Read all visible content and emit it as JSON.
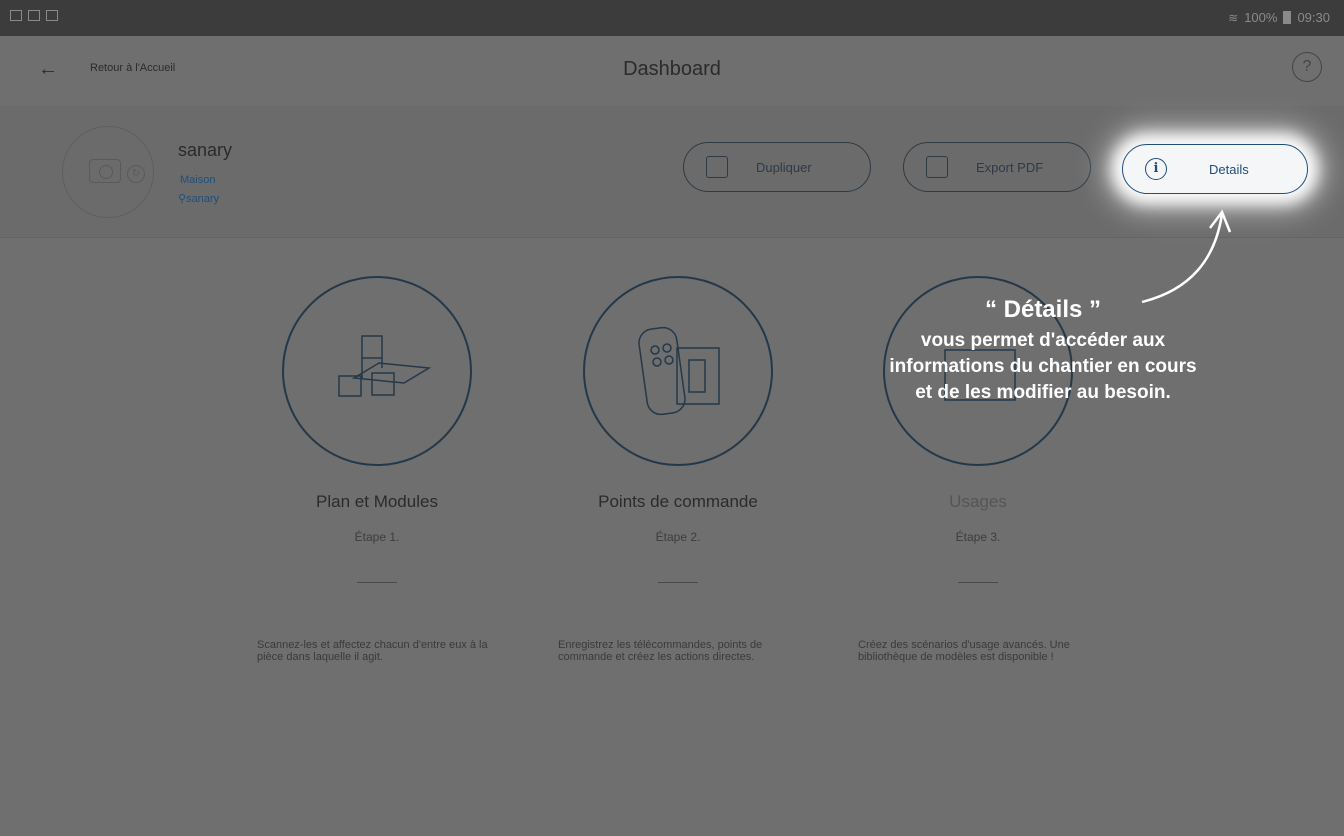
{
  "statusbar": {
    "battery": "100%",
    "time": "09:30"
  },
  "appbar": {
    "back_label": "Retour à l'Accueil",
    "title": "Dashboard",
    "help": "?"
  },
  "project": {
    "name": "sanary",
    "type": "Maison",
    "location": "sanary"
  },
  "actions": {
    "duplicate": "Dupliquer",
    "export": "Export PDF",
    "details": "Details"
  },
  "steps": [
    {
      "name": "Plan et Modules",
      "step": "Étape 1.",
      "desc": "Scannez-les et affectez chacun d'entre eux à la pièce dans laquelle il agit."
    },
    {
      "name": "Points de commande",
      "step": "Étape 2.",
      "desc": "Enregistrez les télécommandes, points de commande et créez les actions directes."
    },
    {
      "name": "Usages",
      "step": "Étape 3.",
      "desc": "Créez des scénarios d'usage avancés. Une bibliothèque de modèles est disponible !"
    }
  ],
  "tooltip": {
    "title": "“ Détails ”",
    "line1": "vous permet d'accéder aux",
    "line2": "informations du chantier en cours",
    "line3": "et de les modifier au besoin."
  }
}
